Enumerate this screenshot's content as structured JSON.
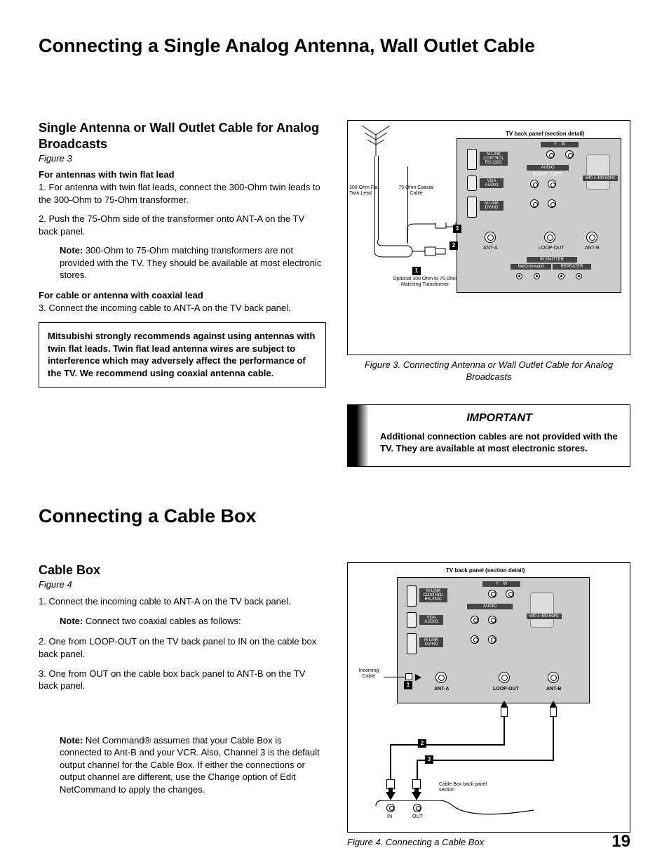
{
  "pageTitle": "Connecting a Single Analog Antenna, Wall Outlet Cable",
  "pageNumber": "19",
  "section1": {
    "heading": "Single Antenna or Wall Outlet Cable for Analog Broadcasts",
    "figRef": "Figure 3",
    "sub1": "For antennas with twin flat lead",
    "step1": "1. For antenna with twin flat leads, connect the 300-Ohm twin leads to the 300-Ohm to 75-Ohm transformer.",
    "step2": "2. Push the 75-Ohm side of the transformer onto ANT-A on the TV back panel.",
    "noteLabel": "Note:",
    "note1": " 300-Ohm to 75-Ohm matching transformers are not provided with the TV.  They should be available at most electronic stores.",
    "sub2": "For cable or antenna with coaxial lead",
    "step3": "3. Connect the incoming cable to ANT-A on the TV back panel.",
    "warn": "Mitsubishi strongly recommends against using antennas with twin flat leads.  Twin flat lead antenna wires are subject to interference which may adversely affect the performance of the TV.  We recommend using coaxial antenna cable."
  },
  "fig3": {
    "caption": "Figure 3. Connecting Antenna or Wall Outlet Cable for Analog Broadcasts",
    "panelLabel": "TV back panel (section detail)",
    "twinLead": "300 Ohm Flat Twin Lead",
    "coax": "75 Ohm Coaxial Cable",
    "transformer": "Optional 300 Ohm to 75 Ohm Matching Transformer",
    "antA": "ANT-A",
    "loopOut": "LOOP-OUT",
    "antB": "ANT-B",
    "netcmd": "NetCommand",
    "repeater": "REPEATER",
    "irEmitter": "IR EMITTER",
    "mlink1": "M-LINK CONTROL RS-232C",
    "vgaAudio": "VGA AUDIO",
    "mlink2": "M-LINK DV/HD",
    "audioRL": "AUDIO",
    "right": "RIGHT",
    "left": "LEFT",
    "vgaRes": "640 x 480 60Hz",
    "y": "Y",
    "w": "W"
  },
  "important": {
    "title": "IMPORTANT",
    "body": "Additional connection cables are not provided with the TV.  They are available at most electronic stores."
  },
  "h2": "Connecting a Cable Box",
  "section2": {
    "heading": "Cable Box",
    "figRef": "Figure 4",
    "step1": "1.  Connect the incoming cable to ANT-A on the TV back panel.",
    "noteLabel": "Note:",
    "note1": "  Connect two coaxial cables as follows:",
    "step2": "2. One from LOOP-OUT on the TV back panel to IN on the cable box back panel.",
    "step3": "3. One from OUT on the cable box back panel to ANT-B on the TV back panel.",
    "note2": "  Net Command® assumes that your Cable Box is connected to Ant-B and your VCR.  Also, Channel 3 is the default output channel for the Cable Box.  If either the connections or output channel are different, use the Change option of Edit NetCommand to apply the changes."
  },
  "fig4": {
    "caption": "Figure 4.  Connecting a Cable Box",
    "panelLabel": "TV back panel (section detail)",
    "incoming": "Incoming Cable",
    "cableBox": "Cable Box back panel section",
    "antA": "ANT-A",
    "loopOut": "LOOP-OUT",
    "antB": "ANT-B",
    "in": "IN",
    "out": "OUT"
  }
}
